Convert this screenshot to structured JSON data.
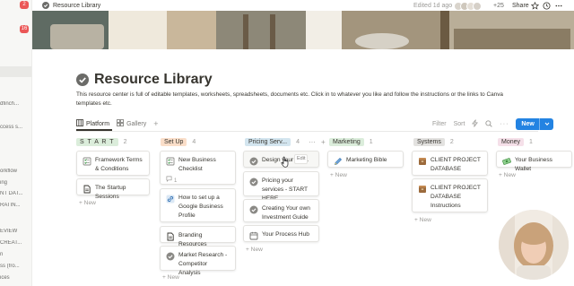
{
  "sidebar": {
    "badges": [
      "2",
      "16"
    ],
    "items": [
      "dfinch...",
      "ccess s...",
      "orkflow",
      "ing",
      "NT DAT...",
      "RATIN...",
      "EVIEW",
      "CREAT...",
      "n",
      "ss (fro...",
      "ices"
    ]
  },
  "topbar": {
    "breadcrumb": "Resource Library",
    "edited": "Edited 1d ago",
    "presence_count": "+25",
    "share": "Share"
  },
  "page": {
    "title": "Resource Library",
    "description": "This resource center is full of editable templates, worksheets, spreadsheets, documents etc. Click in to whatever you like and follow the instructions or the links to Canva templates etc."
  },
  "views": {
    "tabs": [
      {
        "label": "Platform",
        "icon": "board-icon",
        "active": true
      },
      {
        "label": "Gallery",
        "icon": "gallery-icon",
        "active": false
      }
    ],
    "add_view": "+",
    "filter": "Filter",
    "sort": "Sort",
    "new_button": "New"
  },
  "board": {
    "new_label": "+ New",
    "columns": [
      {
        "name": "S T A R T",
        "count": "2",
        "color": "#dbeddb",
        "cards": [
          {
            "icon": "checklist-icon",
            "title": "Framework Terms & Conditions"
          },
          {
            "icon": "document-icon",
            "title": "The Startup Sessions"
          }
        ]
      },
      {
        "name": "Set Up",
        "count": "4",
        "color": "#fadec9",
        "cards": [
          {
            "icon": "checklist-icon",
            "title": "New Business Checklist",
            "comments": "1"
          },
          {
            "icon": "link-icon",
            "title": "How to set up a Google Business Profile"
          },
          {
            "icon": "document-icon",
            "title": "Branding Resources"
          },
          {
            "icon": "check-circle-icon",
            "title": "Market Research - Competitor Analysis"
          }
        ]
      },
      {
        "name": "Pricing Serv...",
        "count": "4",
        "color": "#d3e5ef",
        "cards": [
          {
            "icon": "check-circle-icon",
            "title": "Design your Sal...",
            "edit": "Edit"
          },
          {
            "icon": "check-circle-icon",
            "title": "Pricing your services - START HERE"
          },
          {
            "icon": "check-circle-icon",
            "title": "Creating Your own Investment Guide"
          },
          {
            "icon": "calendar-icon",
            "title": "Your Process Hub"
          }
        ]
      },
      {
        "name": "Marketing",
        "count": "1",
        "color": "#dbeddb",
        "cards": [
          {
            "icon": "pencil-icon",
            "title": "Marketing Bible"
          }
        ]
      },
      {
        "name": "Systems",
        "count": "2",
        "color": "#e3e2e0",
        "cards": [
          {
            "icon": "database-icon",
            "title": "CLIENT PROJECT DATABASE"
          },
          {
            "icon": "database-icon",
            "title": "CLIENT PROJECT DATABASE Instructions"
          }
        ]
      },
      {
        "name": "Money",
        "count": "1",
        "color": "#f5e0e9",
        "cards": [
          {
            "icon": "money-icon",
            "title": "Your Business Wallet"
          }
        ]
      }
    ]
  },
  "colors": {
    "accent": "#2383e2",
    "text": "#37352f",
    "muted": "#9b9a97"
  }
}
